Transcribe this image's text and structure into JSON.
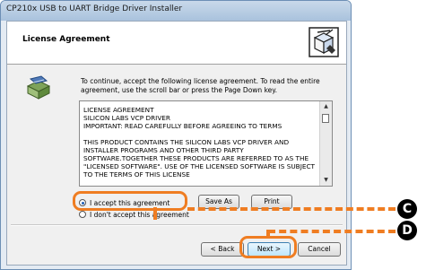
{
  "window": {
    "title": "CP210x USB to UART Bridge Driver Installer"
  },
  "header": {
    "heading": "License Agreement"
  },
  "intro": {
    "text": "To continue, accept the following license agreement. To read the entire agreement, use the scroll bar or press the Page Down key."
  },
  "license": {
    "line1": "LICENSE AGREEMENT",
    "line2": "SILICON LABS VCP DRIVER",
    "line3": "IMPORTANT:  READ CAREFULLY BEFORE AGREEING TO TERMS",
    "paragraph": "THIS PRODUCT CONTAINS THE SILICON LABS VCP DRIVER AND INSTALLER PROGRAMS AND OTHER THIRD PARTY SOFTWARE.TOGETHER THESE PRODUCTS ARE REFERRED TO AS THE \"LICENSED SOFTWARE\".  USE OF THE LICENSED SOFTWARE IS SUBJECT TO THE TERMS OF THIS LICENSE"
  },
  "options": {
    "accept": "I accept this agreement",
    "decline": "I don't accept this agreement",
    "selected": "accept"
  },
  "buttons": {
    "save_as": "Save As",
    "print": "Print",
    "back": "< Back",
    "next": "Next >",
    "cancel": "Cancel"
  },
  "annotations": {
    "c": "C",
    "d": "D",
    "color": "#ef7d22"
  },
  "icons": {
    "logo": "installer-box-icon",
    "intro": "software-package-icon"
  }
}
